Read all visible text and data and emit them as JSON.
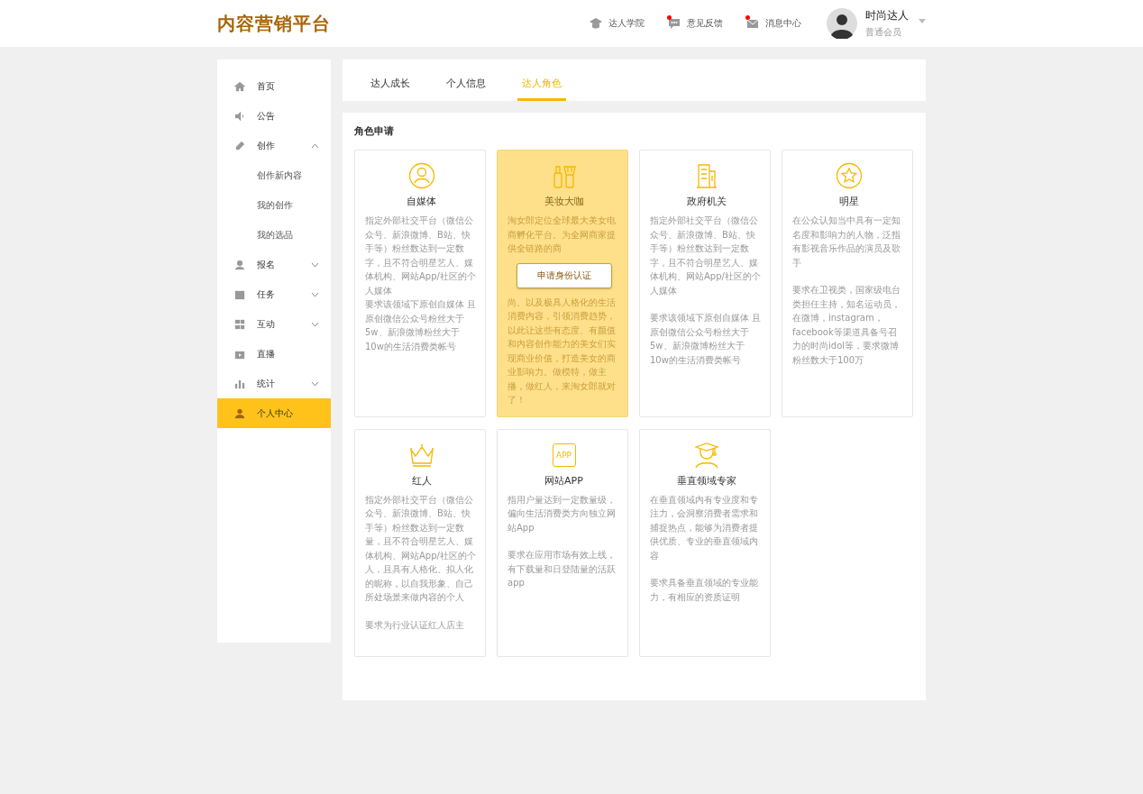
{
  "header": {
    "logo": "内容营销平台",
    "links": [
      {
        "label": "达人学院",
        "dot": false
      },
      {
        "label": "意见反馈",
        "dot": true
      },
      {
        "label": "消息中心",
        "dot": true
      }
    ],
    "user": {
      "name": "时尚达人",
      "role": "普通会员"
    }
  },
  "sidebar": {
    "items": [
      {
        "label": "首页",
        "selected": false
      },
      {
        "label": "公告",
        "selected": false
      },
      {
        "label": "创作",
        "selected": false,
        "expanded": true,
        "children": [
          {
            "label": "创作新内容",
            "selected": false
          },
          {
            "label": "我的创作",
            "selected": false
          },
          {
            "label": "我的选品",
            "selected": false
          }
        ]
      },
      {
        "label": "报名",
        "selected": false,
        "expanded": false
      },
      {
        "label": "任务",
        "selected": false,
        "expanded": false
      },
      {
        "label": "互动",
        "selected": false,
        "expanded": false
      },
      {
        "label": "直播",
        "selected": false
      },
      {
        "label": "统计",
        "selected": false,
        "expanded": false
      },
      {
        "label": "个人中心",
        "selected": true
      }
    ]
  },
  "tabs": [
    {
      "label": "达人成长",
      "selected": false
    },
    {
      "label": "个人信息",
      "selected": false
    },
    {
      "label": "达人角色",
      "selected": true
    }
  ],
  "section_title": "角色申请",
  "cards": [
    {
      "title": "自媒体",
      "highlighted": false,
      "spaced": false,
      "description": [
        "指定外部社交平台（微信公众号、新浪微博、B站、快手等）粉丝数达到一定数字，且不符合明星艺人、媒体机构、网站App/社区的个人媒体",
        "要求该领域下原创自媒体  且原创微信公众号粉丝大于  5w、新浪微博粉丝大于10w的生活消费类帐号"
      ]
    },
    {
      "title": "美妆大咖",
      "highlighted": true,
      "description": [
        "淘女郎定位全球最大美女电商孵化平台。为全网商家提供全链路的商"
      ],
      "description_after": "尚、以及极具人格化的生活消费内容，引领消费趋势，以此让这些有态度、有颜值和内容创作能力的美女们实现商业价值，打造美女的商业影响力。做模特，做主播，做红人，来淘女郎就对了！",
      "action": "申请身份认证"
    },
    {
      "title": "政府机关",
      "highlighted": false,
      "spaced": true,
      "description": [
        "指定外部社交平台（微信公众号、新浪微博、B站、快手等）粉丝数达到一定数字，且不符合明星艺人、媒体机构、网站App/社区的个人媒体",
        "要求该领域下原创自媒体  且原创微信公众号粉丝大于  5w、新浪微博粉丝大于10w的生活消费类帐号"
      ]
    },
    {
      "title": "明星",
      "highlighted": false,
      "spaced": true,
      "description": [
        "在公众认知当中具有一定知名度和影响力的人物，泛指有影视音乐作品的演员及歌手",
        "要求在卫视类，国家级电台类担任主持，知名运动员，在微博，instagram，facebook等渠道具备号召力的时尚idol等，要求微博粉丝数大于100万"
      ]
    },
    {
      "title": "红人",
      "highlighted": false,
      "spaced": true,
      "description": [
        "指定外部社交平台（微信公众号、新浪微博、B站、快手等）粉丝数达到一定数量，且不符合明星艺人、媒体机构、网站App/社区的个人，且具有人格化、拟人化的昵称，以自我形象、自己所处场景来做内容的个人",
        "要求为行业认证红人店主"
      ]
    },
    {
      "title": "网站APP",
      "highlighted": false,
      "icon_text": "APP",
      "spaced": true,
      "description": [
        "指用户量达到一定数量级，偏向生活消费类方向独立网站App",
        "要求在应用市场有效上线，有下载量和日登陆量的活跃app"
      ]
    },
    {
      "title": "垂直领域专家",
      "highlighted": false,
      "spaced": true,
      "description": [
        "在垂直领域内有专业度和专注力，会洞察消费者需求和捕捉热点，能够为消费者提供优质、专业的垂直领域内容",
        "要求具备垂直领域的专业能力，有相应的资质证明"
      ]
    }
  ]
}
